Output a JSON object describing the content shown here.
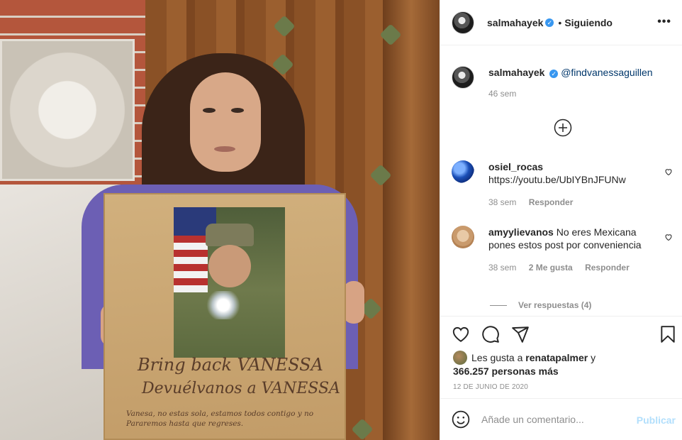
{
  "post": {
    "author": "salmahayek",
    "follow_status": "Siguiendo",
    "separator": "•",
    "more_label": "•••"
  },
  "caption": {
    "username": "salmahayek",
    "mention": "@findvanessaguillen",
    "time": "46 sem"
  },
  "comments": [
    {
      "username": "osiel_rocas",
      "text": "https://youtu.be/UbIYBnJFUNw",
      "time": "38 sem",
      "reply_label": "Responder"
    },
    {
      "username": "amyylievanos",
      "text": "No eres Mexicana pones estos post por conveniencia",
      "time": "38 sem",
      "likes_label": "2 Me gusta",
      "reply_label": "Responder"
    }
  ],
  "view_replies": "Ver respuestas (4)",
  "likes": {
    "prefix": "Les gusta a",
    "user": "renatapalmer",
    "connector": "y",
    "count": "366.257 personas más"
  },
  "date": "12 DE JUNIO DE 2020",
  "comment_bar": {
    "placeholder": "Añade un comentario...",
    "publish_label": "Publicar"
  },
  "sign": {
    "line1": "Bring back VANESSA",
    "line2": "Devuélvanos a VANESSA",
    "line3": "Vanesa, no estas sola, estamos todos contigo y no Pararemos hasta que regreses."
  },
  "colors": {
    "verified": "#3897f0",
    "link": "#00376b",
    "publish_disabled": "#b2dffc",
    "meta": "#8e8e8e"
  },
  "icons": [
    "verified-badge-icon",
    "add-circle-icon",
    "heart-icon",
    "comment-icon",
    "share-icon",
    "bookmark-icon",
    "emoji-icon",
    "more-icon"
  ]
}
